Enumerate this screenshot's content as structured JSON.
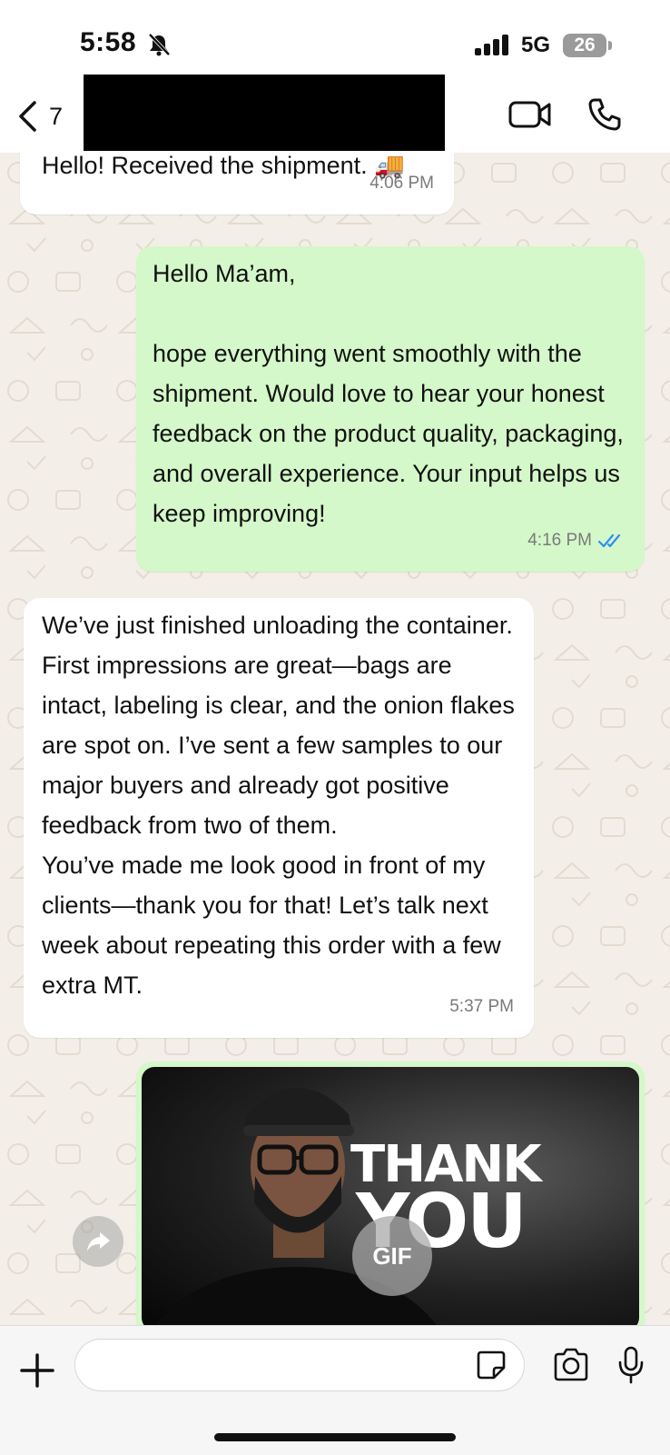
{
  "status_bar": {
    "time": "5:58",
    "network": "5G",
    "battery": "26"
  },
  "header": {
    "back_count": "7"
  },
  "messages": [
    {
      "direction": "in",
      "text": "Hello! Received the shipment. 🚚",
      "time": "4:06 PM"
    },
    {
      "direction": "out",
      "text": "Hello Ma’am,\n\nhope everything went smoothly with the shipment. Would love to hear your honest feedback on the product quality, packaging, and overall experience. Your input helps us keep improving!",
      "time": "4:16 PM",
      "read": true
    },
    {
      "direction": "in",
      "text": "We’ve just finished unloading the container. First impressions are great—bags are intact, labeling is clear, and the onion flakes are spot on. I’ve sent a few samples to our major buyers and already got positive feedback from two of them.\nYou’ve made me look good in front of my clients—thank you for that! Let’s talk next week about repeating this order with a few extra MT.",
      "time": "5:37 PM"
    },
    {
      "direction": "out",
      "type": "gif",
      "gif_text_line1": "THANK",
      "gif_text_line2": "YOU",
      "badge": "GIF"
    }
  ],
  "composer": {
    "placeholder": ""
  },
  "colors": {
    "outgoing_bubble": "#d4f8c9",
    "incoming_bubble": "#ffffff",
    "read_ticks": "#2f8ff0",
    "wallpaper": "#f3efe8"
  },
  "icons": [
    "mute-icon",
    "signal-icon",
    "chevron-left-icon",
    "video-call-icon",
    "phone-icon",
    "double-check-icon",
    "forward-icon",
    "plus-icon",
    "sticker-icon",
    "camera-icon",
    "microphone-icon"
  ]
}
